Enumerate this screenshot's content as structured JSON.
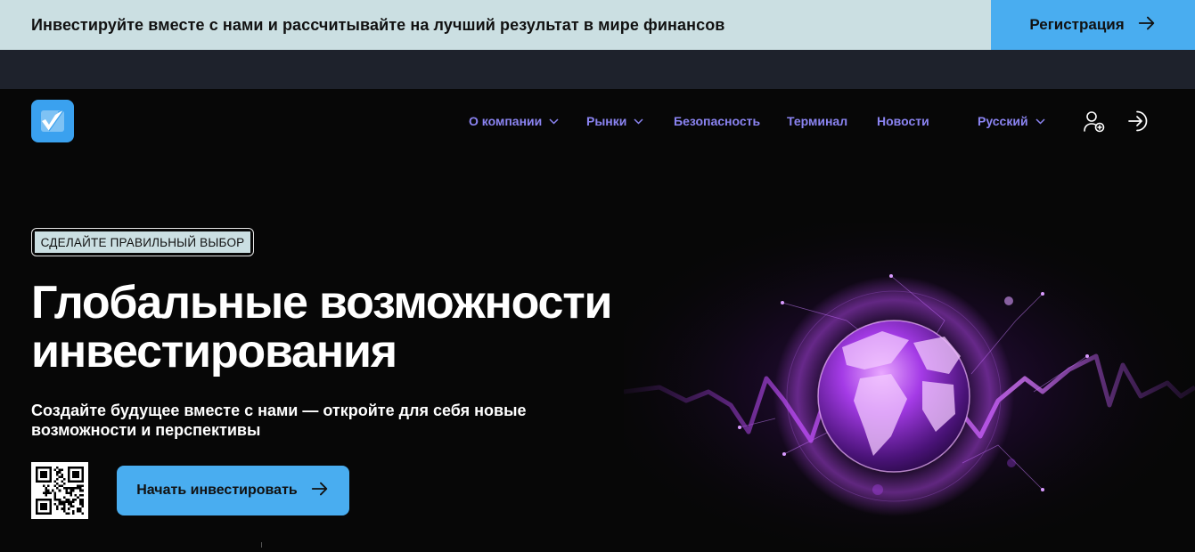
{
  "topbar": {
    "text": "Инвестируйте вместе с нами и рассчитывайте на лучший результат в мире финансов",
    "register_label": "Регистрация"
  },
  "nav": {
    "items": [
      {
        "label": "О компании",
        "has_dropdown": true
      },
      {
        "label": "Рынки",
        "has_dropdown": true
      },
      {
        "label": "Безопасность",
        "has_dropdown": false
      },
      {
        "label": "Терминал",
        "has_dropdown": false
      },
      {
        "label": "Новости",
        "has_dropdown": false
      }
    ],
    "language": "Русский",
    "icons": [
      "add-user-icon",
      "login-icon"
    ]
  },
  "hero": {
    "badge": "СДЕЛАЙТЕ ПРАВИЛЬНЫЙ ВЫБОР",
    "title_line1": "Глобальные возможности",
    "title_line2": "инвестирования",
    "subtitle": "Создайте будущее вместе с нами — откройте для себя новые возможности и перспективы",
    "cta_label": "Начать инвестировать"
  },
  "colors": {
    "topbar_bg": "#cbdfe2",
    "accent_blue": "#49adf0",
    "nav_link": "#8b84f2",
    "page_bg": "#070707",
    "glow_purple": "#c24dff"
  }
}
